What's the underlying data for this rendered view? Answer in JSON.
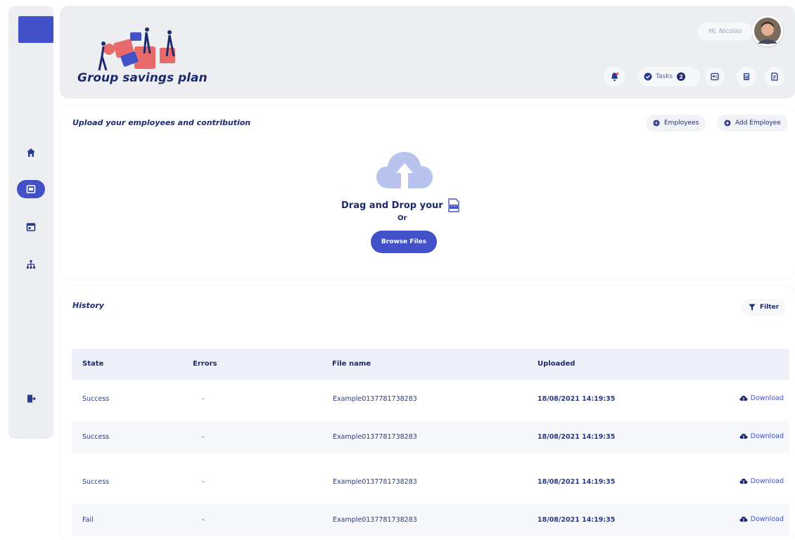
{
  "header": {
    "brand_title": "Group savings plan",
    "greeting": "Hi, Nicolas",
    "tasks_label": "Tasks",
    "tasks_count": "2"
  },
  "upload": {
    "title": "Upload your employees and contribution",
    "employees_label": "Employees",
    "add_employee_label": "Add Employee",
    "drag_text": "Drag and Drop your",
    "or_text": "Or",
    "browse_label": "Browse Files"
  },
  "history": {
    "title": "History",
    "filter_label": "Filter",
    "columns": [
      "State",
      "Errors",
      "File name",
      "Uploaded"
    ],
    "rows": [
      {
        "state": "Success",
        "errors": "-",
        "file": "Example0137781738283",
        "uploaded": "18/08/2021 14:19:35",
        "action": "Download"
      },
      {
        "state": "Success",
        "errors": "-",
        "file": "Example0137781738283",
        "uploaded": "18/08/2021 14:19:35",
        "action": "Download"
      },
      {
        "state": "Success",
        "errors": "-",
        "file": "Example0137781738283",
        "uploaded": "18/08/2021 14:19:35",
        "action": "Download"
      },
      {
        "state": "Fail",
        "errors": "-",
        "file": "Example0137781738283",
        "uploaded": "18/08/2021 14:19:35",
        "action": "Download"
      }
    ]
  },
  "colors": {
    "accent": "#4351c9",
    "navy": "#1e2a6e",
    "panel": "#eceef1"
  }
}
